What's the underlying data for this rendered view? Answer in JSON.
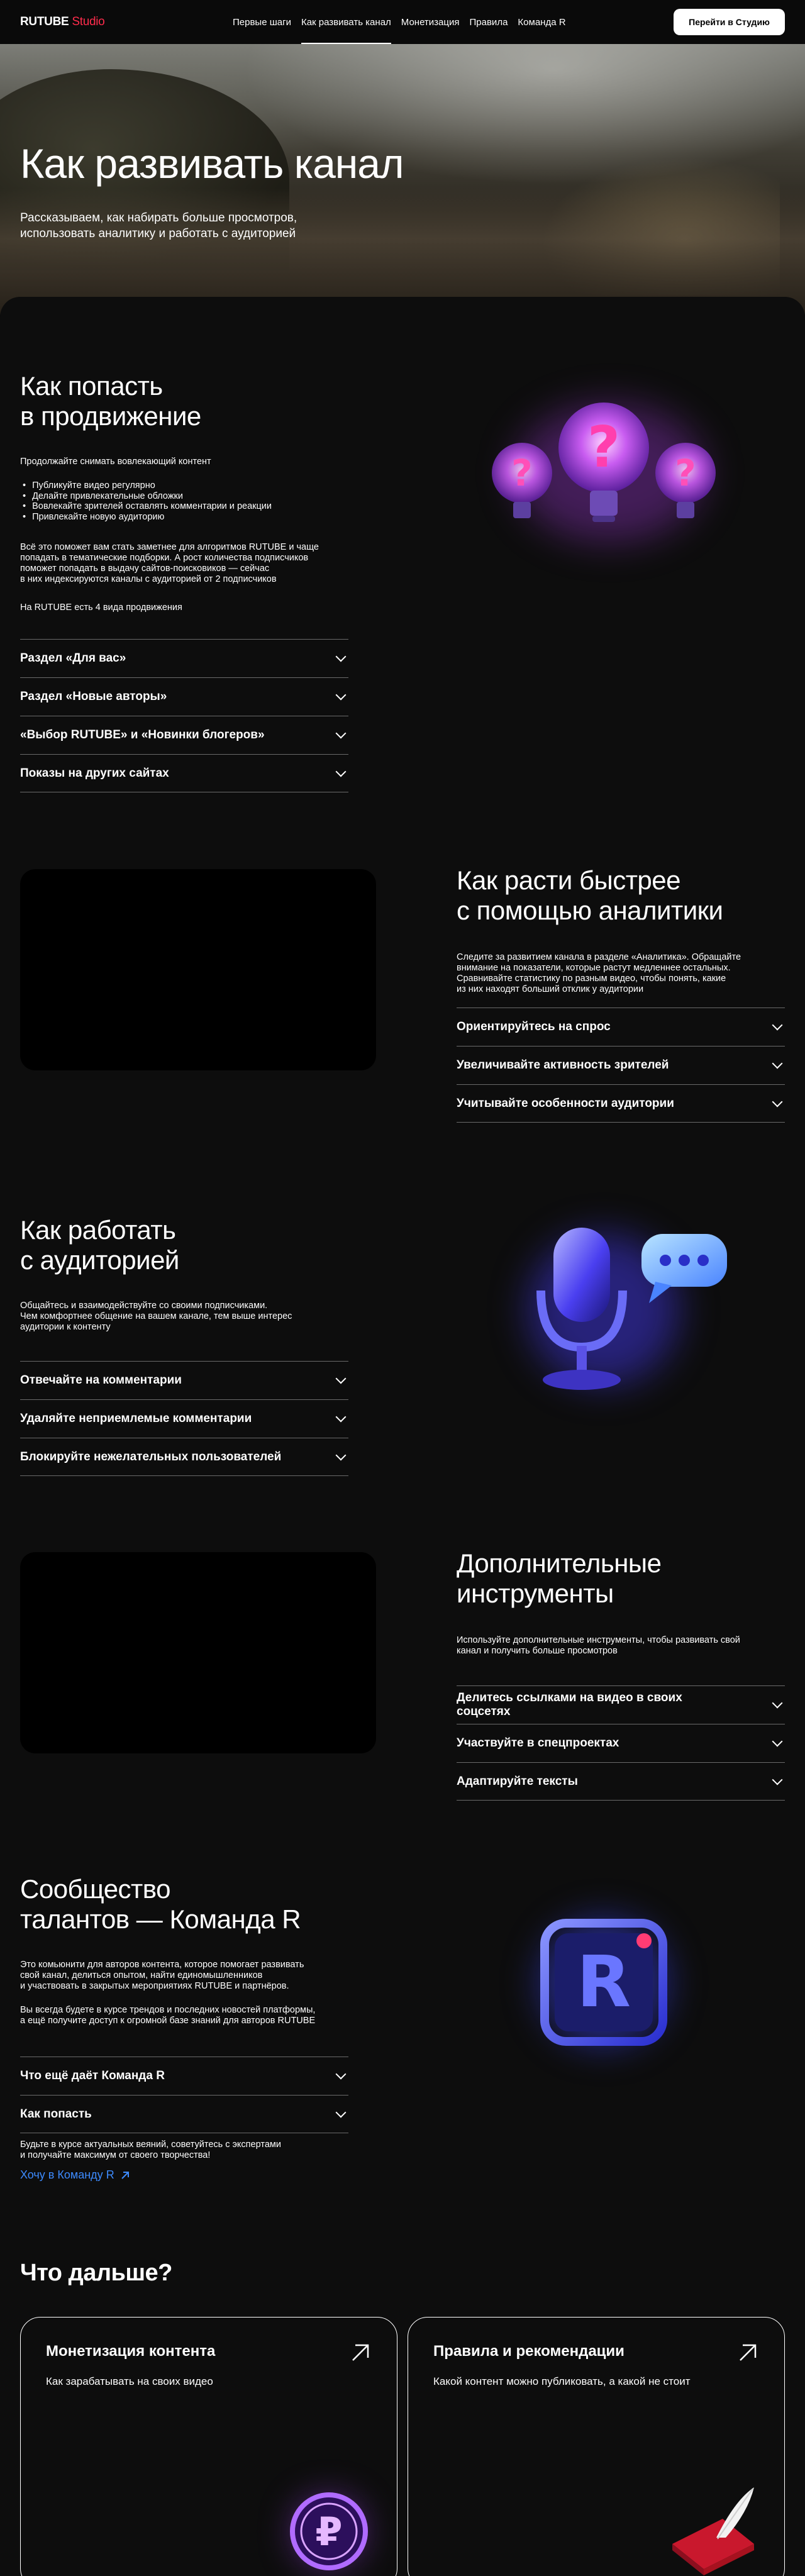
{
  "nav": {
    "logo_main": "RUTUBE",
    "logo_accent": "Studio",
    "links": [
      "Первые шаги",
      "Как развивать канал",
      "Монетизация",
      "Правила",
      "Команда R"
    ],
    "active_index": 1,
    "cta": "Перейти в Студию"
  },
  "hero": {
    "title": "Как развивать канал",
    "subtitle": "Рассказываем, как набирать больше просмотров,\nиспользовать аналитику и работать с аудиторией"
  },
  "promo": {
    "title": "Как попасть\nв продвижение",
    "intro": "Продолжайте снимать вовлекающий контент",
    "bullets": [
      "Публикуйте видео регулярно",
      "Делайте привлекательные обложки",
      "Вовлекайте зрителей оставлять комментарии и реакции",
      "Привлекайте новую аудиторию"
    ],
    "para": "Всё это поможет вам стать заметнее для алгоритмов RUTUBE и чаще\nпопадать в тематические подборки. А рост количества подписчиков\nпоможет попадать в выдачу сайтов-поисковиков — сейчас\nв них индексируются каналы с аудиторией от 2 подписчиков",
    "kinds": "На RUTUBE есть 4 вида продвижения",
    "accordion": [
      "Раздел «Для вас»",
      "Раздел «Новые авторы»",
      "«Выбор RUTUBE» и «Новинки блогеров»",
      "Показы на других сайтах"
    ]
  },
  "analytics": {
    "title": "Как расти быстрее\nс помощью аналитики",
    "para": "Следите за развитием канала в разделе «Аналитика». Обращайте\nвнимание на показатели, которые растут медленнее остальных.\nСравнивайте статистику по разным видео, чтобы понять, какие\nиз них находят больший отклик у аудитории",
    "accordion": [
      "Ориентируйтесь на спрос",
      "Увеличивайте активность зрителей",
      "Учитывайте особенности аудитории"
    ]
  },
  "audience": {
    "title": "Как работать\nс аудиторией",
    "para": "Общайтесь и взаимодействуйте со своими подписчиками.\nЧем комфортнее общение на вашем канале, тем выше интерес\nаудитории к контенту",
    "accordion": [
      "Отвечайте на комментарии",
      "Удаляйте неприемлемые комментарии",
      "Блокируйте нежелательных пользователей"
    ]
  },
  "tools": {
    "title": "Дополнительные\nинструменты",
    "para": "Используйте дополнительные инструменты, чтобы развивать свой\nканал и получить больше просмотров",
    "accordion": [
      "Делитесь ссылками на видео в своих соцсетях",
      "Участвуйте в спецпроектах",
      "Адаптируйте тексты"
    ]
  },
  "community": {
    "title": "Сообщество\nталантов — Команда R",
    "para1": "Это комьюнити для авторов контента, которое помогает развивать\nсвой канал, делиться опытом, найти единомышленников\nи участвовать в закрытых мероприятиях RUTUBE и партнёров.",
    "para2": "Вы всегда будете в курсе трендов и последних новостей платформы,\nа ещё получите доступ к огромной базе знаний для авторов RUTUBE",
    "accordion": [
      "Что ещё даёт Команда R",
      "Как попасть"
    ],
    "note": "Будьте в курсе актуальных веяний, советуйтесь с экспертами\nи получайте максимум от своего творчества!",
    "link": "Хочу в Команду R",
    "badge_letter": "R"
  },
  "next": {
    "title": "Что дальше?",
    "cards": [
      {
        "title": "Монетизация контента",
        "subtitle": "Как зарабатывать на своих видео"
      },
      {
        "title": "Правила и рекомендации",
        "subtitle": "Какой контент можно публиковать, а какой не стоит"
      }
    ]
  },
  "colors": {
    "accent_red": "#ff2c4c",
    "link_blue": "#3d8bff",
    "bg": "#0d0d0d"
  }
}
